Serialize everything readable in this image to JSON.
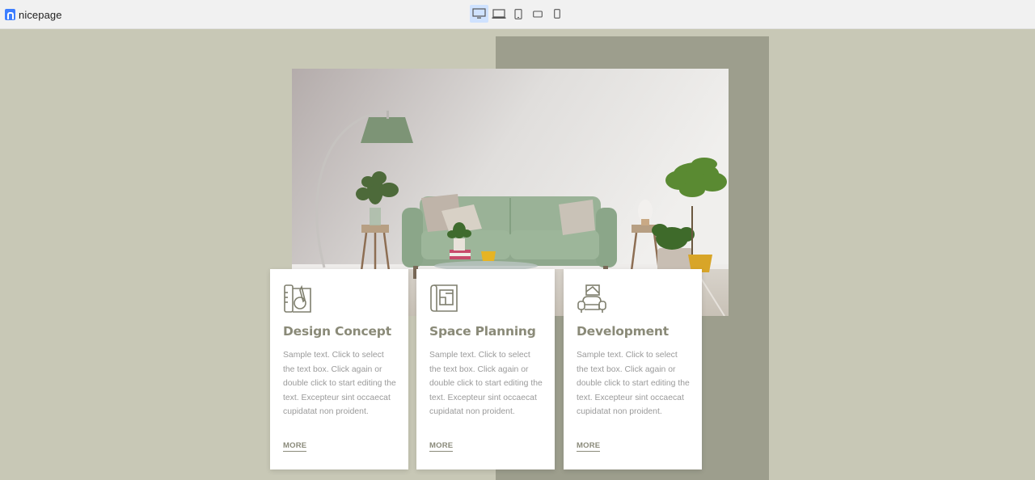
{
  "app": {
    "name": "nicepage"
  },
  "toolbar": {
    "devices": [
      {
        "name": "desktop",
        "active": true
      },
      {
        "name": "laptop",
        "active": false
      },
      {
        "name": "tablet",
        "active": false
      },
      {
        "name": "phone-landscape",
        "active": false
      },
      {
        "name": "phone",
        "active": false
      }
    ]
  },
  "colors": {
    "page_bg": "#c8c8b6",
    "panel_bg": "#9d9e8d",
    "accent_text": "#8a8a78",
    "brand": "#3d7eff"
  },
  "cards": [
    {
      "icon": "design-concept-icon",
      "title": "Design Concept",
      "text": "Sample text. Click to select the text box. Click again or double click to start editing the text. Excepteur sint occaecat cupidatat non proident.",
      "link": "MORE"
    },
    {
      "icon": "blueprint-icon",
      "title": "Space Planning",
      "text": "Sample text. Click to select the text box. Click again or double click to start editing the text. Excepteur sint occaecat cupidatat non proident.",
      "link": "MORE"
    },
    {
      "icon": "armchair-icon",
      "title": "Development",
      "text": "Sample text. Click to select the text box. Click again or double click to start editing the text. Excepteur sint occaecat cupidatat non proident.",
      "link": "MORE"
    }
  ]
}
